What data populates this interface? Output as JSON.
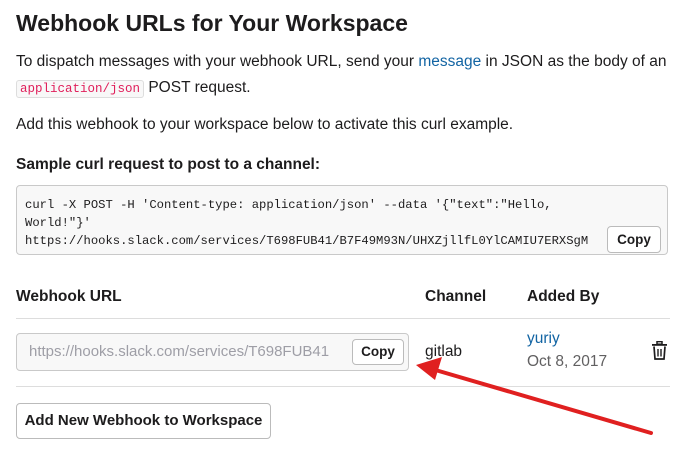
{
  "page": {
    "title": "Webhook URLs for Your Workspace"
  },
  "intro": {
    "text_before_link": "To dispatch messages with your webhook URL, send your ",
    "link_text": "message",
    "text_after_link": " in JSON as the body of an ",
    "code": "application/json",
    "text_end": " POST request."
  },
  "activate_text": "Add this webhook to your workspace below to activate this curl example.",
  "sample": {
    "heading": "Sample curl request to post to a channel:",
    "lines": [
      "curl -X POST -H 'Content-type: application/json' --data '{\"text\":\"Hello,",
      "World!\"}'",
      "https://hooks.slack.com/services/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"
    ],
    "copy_label": "Copy"
  },
  "table": {
    "headers": {
      "url": "Webhook URL",
      "channel": "Channel",
      "added_by": "Added By"
    },
    "rows": [
      {
        "url": "https://hooks.slack.com/services/T698FUB41",
        "copy_label": "Copy",
        "channel": "gitlab",
        "user": "yuriy",
        "date": "Oct 8, 2017",
        "delete_icon": "trash-icon"
      }
    ]
  },
  "add_button_label": "Add New Webhook to Workspace",
  "colors": {
    "link": "#1264a3",
    "code": "#e01e5a",
    "annotation_arrow": "#e02020"
  }
}
